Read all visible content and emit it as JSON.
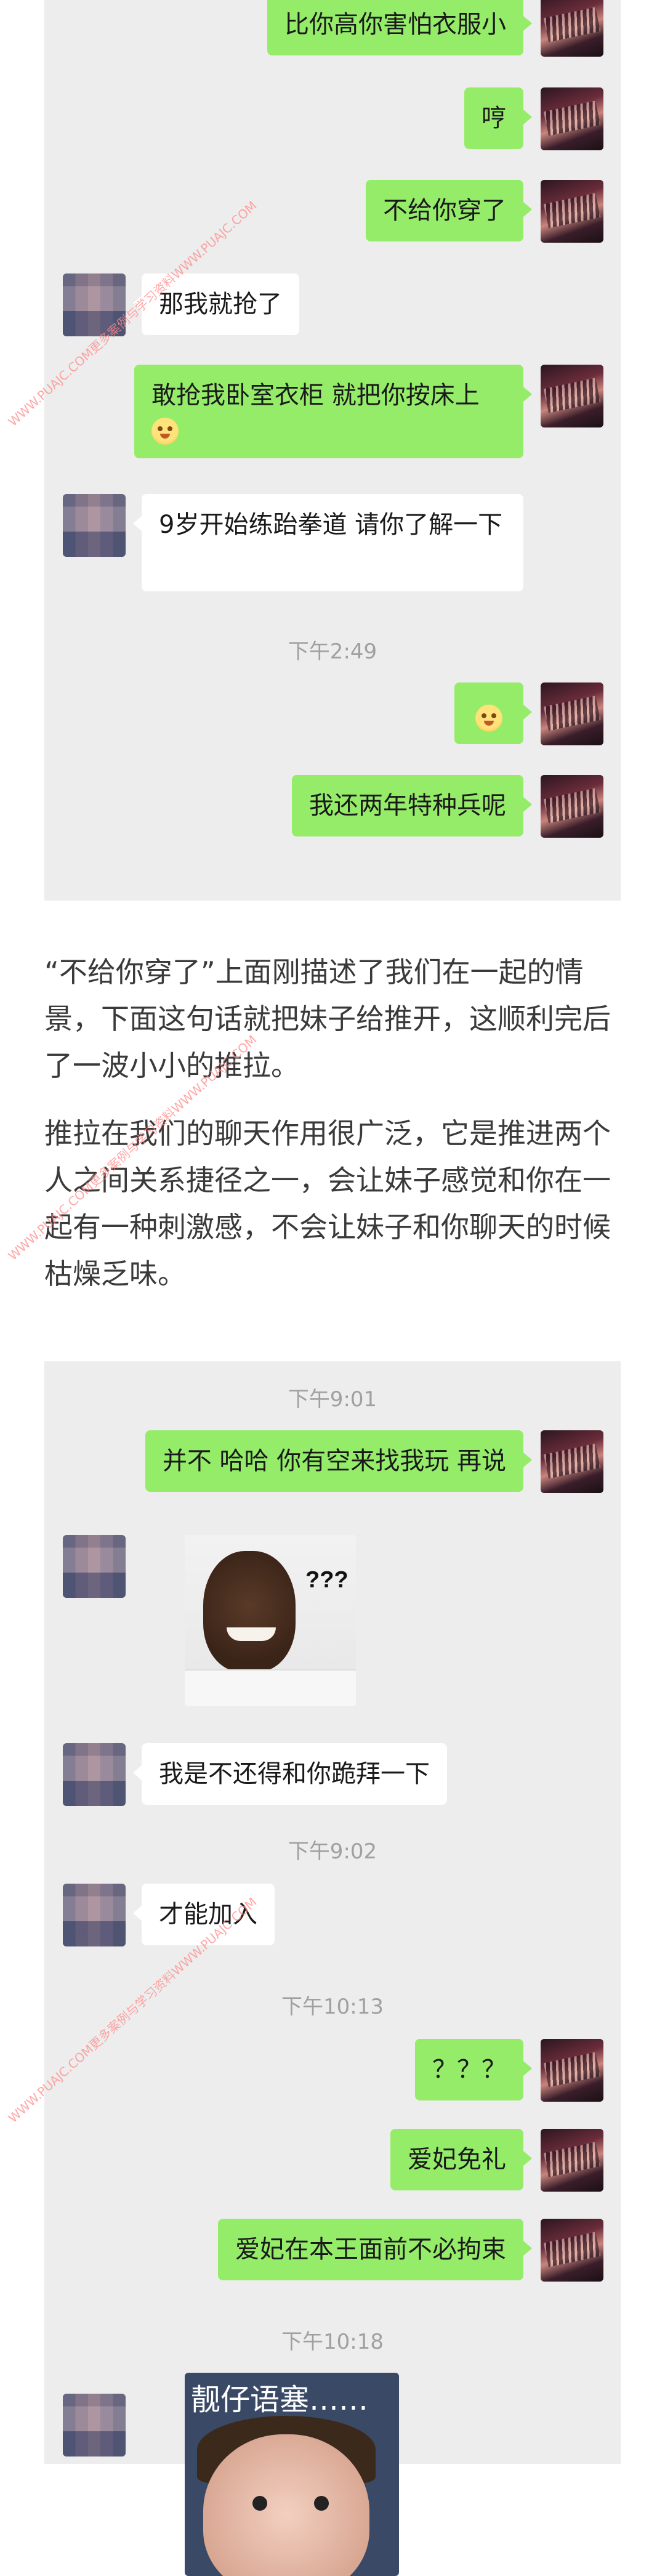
{
  "chat1": {
    "messages": [
      {
        "side": "me",
        "text": "比你高你害怕衣服小"
      },
      {
        "side": "me",
        "text": "哼"
      },
      {
        "side": "me",
        "text": "不给你穿了"
      },
      {
        "side": "her",
        "text": "那我就抢了"
      },
      {
        "side": "me",
        "text": "敢抢我卧室衣柜 就把你按床上",
        "emoji": "cookie-emoji"
      },
      {
        "side": "her",
        "text": "9岁开始练跆拳道 请你了解一下"
      },
      {
        "time": "下午2:49"
      },
      {
        "side": "me",
        "emoji": "sneaky-face-emoji"
      },
      {
        "side": "me",
        "text": "我还两年特种兵呢"
      }
    ]
  },
  "article": {
    "paragraph1": "“不给你穿了”上面刚描述了我们在一起的情景，下面这句话就把妹子给推开，这顺利完后了一波小小的推拉。",
    "paragraph2": "推拉在我们的聊天作用很广泛，它是推进两个人之间关系捷径之一，会让妹子感觉和你在一起有一种刺激感，不会让妹子和你聊天的时候枯燥乏味。"
  },
  "chat2": {
    "time1": "下午9:01",
    "msg1": "并不 哈哈 你有空来找我玩 再说",
    "sticker1_text": "???",
    "msg2": "我是不还得和你跪拜一下",
    "time2": "下午9:02",
    "msg3": "才能加入",
    "time3": "下午10:13",
    "msg4": "？？？",
    "msg5": "爱妃免礼",
    "msg6": "爱妃在本王面前不必拘束",
    "time4": "下午10:18",
    "sticker2_caption": "靓仔语塞……"
  },
  "watermark": {
    "text": "WWW.PUAJC.COM更多案例与学习资料WWW.PUAJC.COM"
  },
  "colors": {
    "chat_bg": "#ededed",
    "my_bubble": "#95ec69",
    "her_bubble": "#ffffff",
    "timestamp": "#a0a0a0",
    "watermark": "#ff8b8b"
  }
}
